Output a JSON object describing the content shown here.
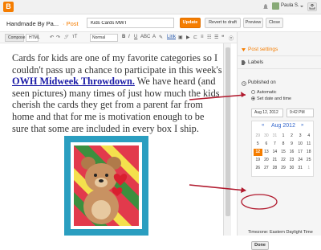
{
  "app": {
    "logo": "B",
    "user_name": "Paula S."
  },
  "header": {
    "blog_name": "Handmade By Pa...",
    "post_label": "· Post",
    "post_title": "Kids Cards MWT",
    "update_label": "Update",
    "revert_label": "Revert to draft",
    "preview_label": "Preview",
    "close_label": "Close"
  },
  "toolbar": {
    "compose_label": "Compose",
    "html_label": "HTML",
    "font_label": "Normal"
  },
  "editor": {
    "text_before_link": "Cards for kids are one of my favorite categories so I couldn't pass up a chance to participate in this week's ",
    "link_text": "OWH Midweek Throwdown.",
    "text_after_link": " We have heard (and seen pictures) many times of just how much the kids cherish the cards they get from a parent far from home and that for me is motivation enough to be sure that some are included in every box I ship."
  },
  "sidebar": {
    "post_settings_label": "Post settings",
    "labels_label": "Labels",
    "published_on_label": "Published on",
    "automatic_label": "Automatic",
    "set_date_label": "Set date and time",
    "date_value": "Aug 12, 2012",
    "time_value": "9:42 PM",
    "calendar": {
      "month_label": "Aug 2012",
      "prev": "«",
      "next": "»",
      "days": [
        "29",
        "30",
        "31",
        "1",
        "2",
        "3",
        "4",
        "5",
        "6",
        "7",
        "8",
        "9",
        "10",
        "11",
        "12",
        "13",
        "14",
        "15",
        "16",
        "17",
        "18",
        "19",
        "20",
        "21",
        "22",
        "23",
        "24",
        "25",
        "26",
        "27",
        "28",
        "29",
        "30",
        "31",
        "1"
      ],
      "selected": "12"
    },
    "timezone_label": "Timezone: Eastern Daylight Time",
    "done_label": "Done"
  },
  "colors": {
    "accent": "#f57d00",
    "link": "#1a1aa6",
    "annotation": "#b11a2e"
  }
}
